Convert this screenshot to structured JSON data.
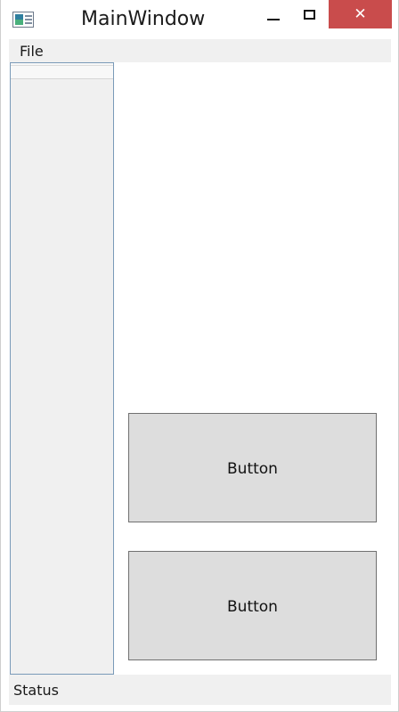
{
  "window": {
    "title": "MainWindow",
    "close_glyph": "✕"
  },
  "menu": {
    "items": [
      {
        "label": "File"
      }
    ]
  },
  "main": {
    "buttons": [
      {
        "label": "Button"
      },
      {
        "label": "Button"
      }
    ]
  },
  "status": {
    "text": "Status"
  },
  "colors": {
    "close_button": "#c94c4c",
    "button_face": "#dddddd",
    "list_border": "#7a9ab8"
  },
  "icons": [
    "app-icon",
    "minimize-icon",
    "maximize-icon",
    "close-icon"
  ]
}
